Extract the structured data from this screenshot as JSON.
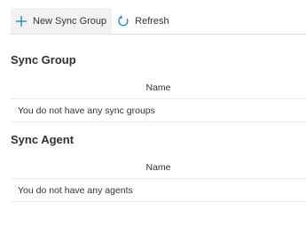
{
  "toolbar": {
    "new_sync_group_label": "New Sync Group",
    "refresh_label": "Refresh"
  },
  "sync_group": {
    "title": "Sync Group",
    "column_header": "Name",
    "empty_message": "You do not have any sync groups"
  },
  "sync_agent": {
    "title": "Sync Agent",
    "column_header": "Name",
    "empty_message": "You do not have any agents"
  },
  "colors": {
    "accent": "#0078d4",
    "text": "#323130",
    "divider": "#edebe9"
  },
  "icons": {
    "new": "plus-icon",
    "refresh": "refresh-icon"
  }
}
